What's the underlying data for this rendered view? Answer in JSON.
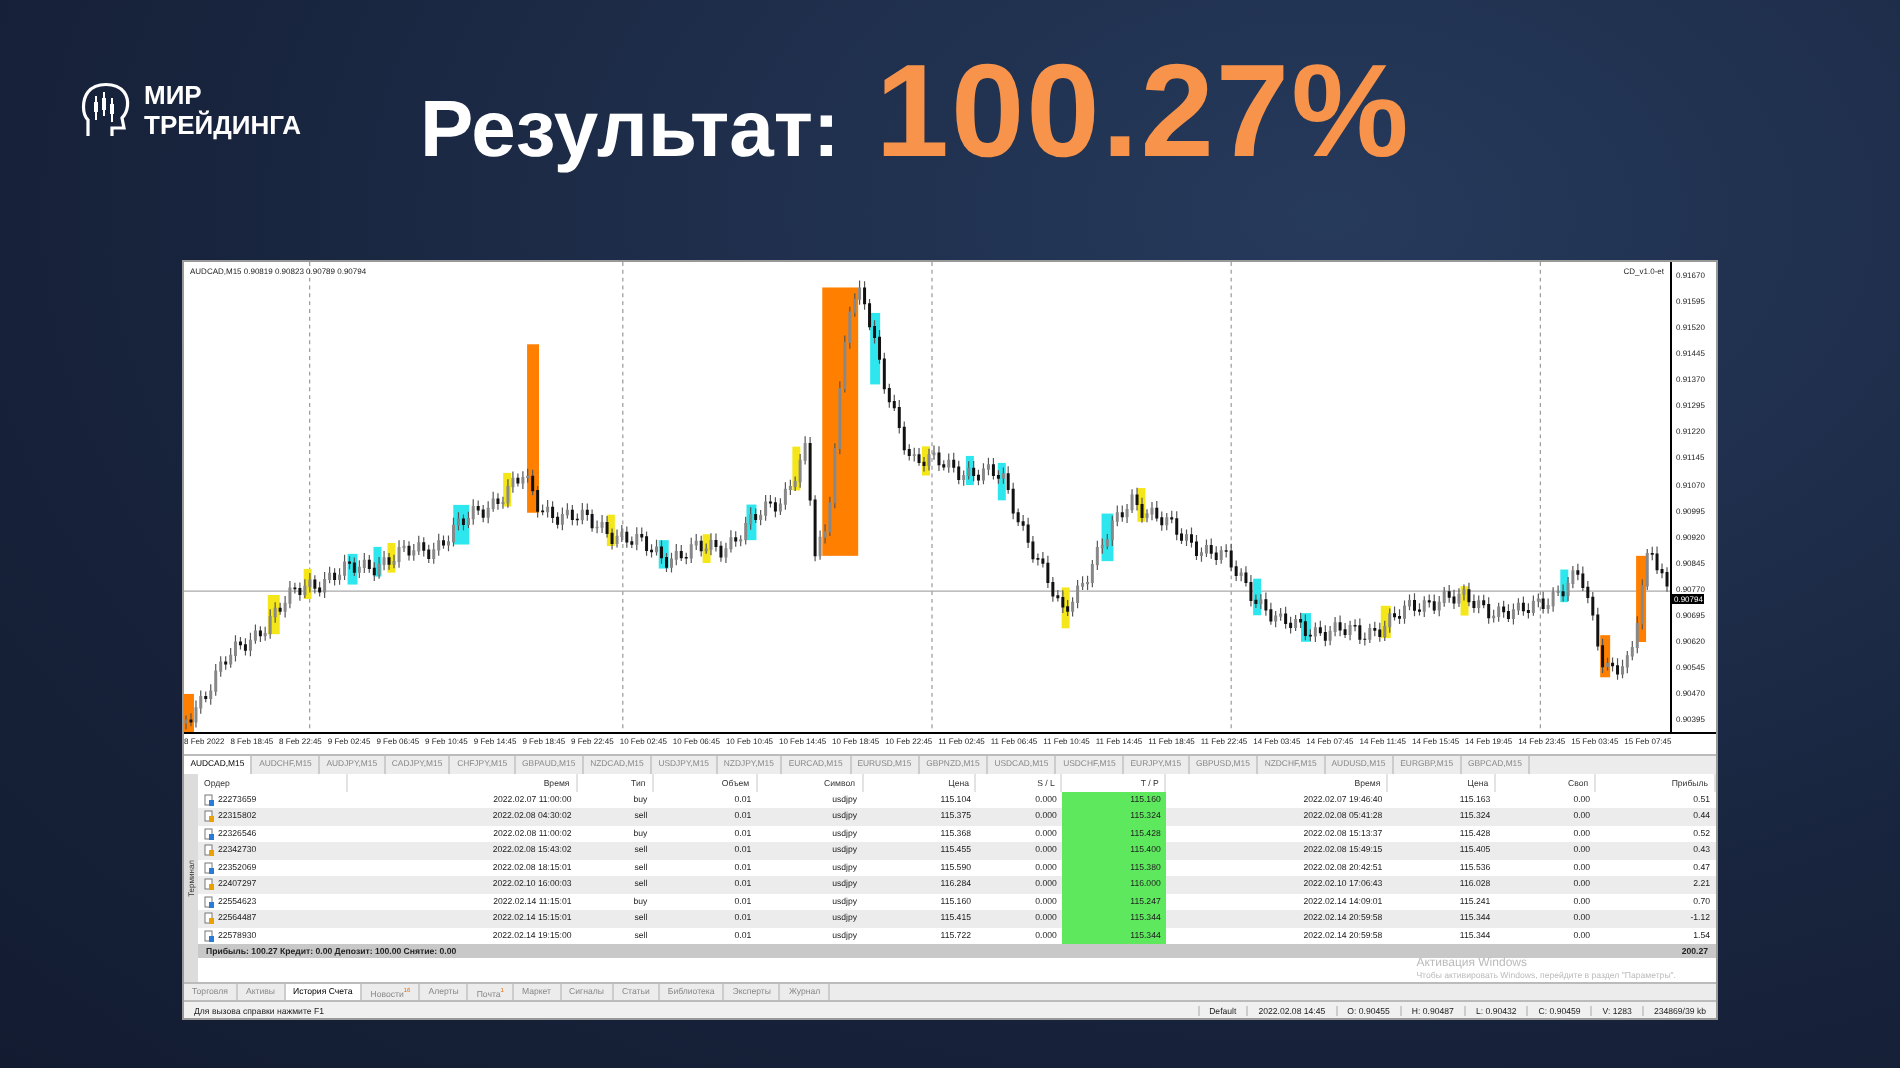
{
  "brand": {
    "lines": [
      "МИР",
      "ТРЕЙДИНГА"
    ]
  },
  "headline": {
    "label": "Результат:",
    "value": "100.27%"
  },
  "chart": {
    "symbol_info": "AUDCAD,M15  0.90819 0.90823 0.90789 0.90794",
    "indicator": "CD_v1.0-et",
    "price_marker": "0.90794",
    "price_ticks": [
      "0.91670",
      "0.91595",
      "0.91520",
      "0.91445",
      "0.91370",
      "0.91295",
      "0.91220",
      "0.91145",
      "0.91070",
      "0.90995",
      "0.90920",
      "0.90845",
      "0.90770",
      "0.90695",
      "0.90620",
      "0.90545",
      "0.90470",
      "0.90395"
    ],
    "time_ticks": [
      "8 Feb 2022",
      "8 Feb 18:45",
      "8 Feb 22:45",
      "9 Feb 02:45",
      "9 Feb 06:45",
      "9 Feb 10:45",
      "9 Feb 14:45",
      "9 Feb 18:45",
      "9 Feb 22:45",
      "10 Feb 02:45",
      "10 Feb 06:45",
      "10 Feb 10:45",
      "10 Feb 14:45",
      "10 Feb 18:45",
      "10 Feb 22:45",
      "11 Feb 02:45",
      "11 Feb 06:45",
      "11 Feb 10:45",
      "11 Feb 14:45",
      "11 Feb 18:45",
      "11 Feb 22:45",
      "14 Feb 03:45",
      "14 Feb 07:45",
      "14 Feb 11:45",
      "14 Feb 15:45",
      "14 Feb 19:45",
      "14 Feb 23:45",
      "15 Feb 03:45",
      "15 Feb 07:45"
    ]
  },
  "symbol_tabs": [
    {
      "label": "AUDCAD,M15",
      "selected": true
    },
    {
      "label": "AUDCHF,M15",
      "selected": false
    },
    {
      "label": "AUDJPY,M15",
      "selected": false
    },
    {
      "label": "CADJPY,M15",
      "selected": false
    },
    {
      "label": "CHFJPY,M15",
      "selected": false
    },
    {
      "label": "GBPAUD,M15",
      "selected": false
    },
    {
      "label": "NZDCAD,M15",
      "selected": false
    },
    {
      "label": "USDJPY,M15",
      "selected": false
    },
    {
      "label": "NZDJPY,M15",
      "selected": false
    },
    {
      "label": "EURCAD,M15",
      "selected": false
    },
    {
      "label": "EURUSD,M15",
      "selected": false
    },
    {
      "label": "GBPNZD,M15",
      "selected": false
    },
    {
      "label": "USDCAD,M15",
      "selected": false
    },
    {
      "label": "USDCHF,M15",
      "selected": false
    },
    {
      "label": "EURJPY,M15",
      "selected": false
    },
    {
      "label": "GBPUSD,M15",
      "selected": false
    },
    {
      "label": "NZDCHF,M15",
      "selected": false
    },
    {
      "label": "AUDUSD,M15",
      "selected": false
    },
    {
      "label": "EURGBP,M15",
      "selected": false
    },
    {
      "label": "GBPCAD,M15",
      "selected": false
    }
  ],
  "terminal": {
    "side_label": "Терминал",
    "columns": [
      "Ордер",
      "Время",
      "Тип",
      "Объем",
      "Символ",
      "Цена",
      "S / L",
      "T / P",
      "Время",
      "Цена",
      "Своп",
      "Прибыль"
    ],
    "rows": [
      [
        "22273659",
        "2022.02.07 11:00:00",
        "buy",
        "0.01",
        "usdjpy",
        "115.104",
        "0.000",
        "115.160",
        "2022.02.07 19:46:40",
        "115.163",
        "0.00",
        "0.51"
      ],
      [
        "22315802",
        "2022.02.08 04:30:02",
        "sell",
        "0.01",
        "usdjpy",
        "115.375",
        "0.000",
        "115.324",
        "2022.02.08 05:41:28",
        "115.324",
        "0.00",
        "0.44"
      ],
      [
        "22326546",
        "2022.02.08 11:00:02",
        "buy",
        "0.01",
        "usdjpy",
        "115.368",
        "0.000",
        "115.428",
        "2022.02.08 15:13:37",
        "115.428",
        "0.00",
        "0.52"
      ],
      [
        "22342730",
        "2022.02.08 15:43:02",
        "sell",
        "0.01",
        "usdjpy",
        "115.455",
        "0.000",
        "115.400",
        "2022.02.08 15:49:15",
        "115.405",
        "0.00",
        "0.43"
      ],
      [
        "22352069",
        "2022.02.08 18:15:01",
        "sell",
        "0.01",
        "usdjpy",
        "115.590",
        "0.000",
        "115.380",
        "2022.02.08 20:42:51",
        "115.536",
        "0.00",
        "0.47"
      ],
      [
        "22407297",
        "2022.02.10 16:00:03",
        "sell",
        "0.01",
        "usdjpy",
        "116.284",
        "0.000",
        "116.000",
        "2022.02.10 17:06:43",
        "116.028",
        "0.00",
        "2.21"
      ],
      [
        "22554623",
        "2022.02.14 11:15:01",
        "buy",
        "0.01",
        "usdjpy",
        "115.160",
        "0.000",
        "115.247",
        "2022.02.14 14:09:01",
        "115.241",
        "0.00",
        "0.70"
      ],
      [
        "22564487",
        "2022.02.14 15:15:01",
        "sell",
        "0.01",
        "usdjpy",
        "115.415",
        "0.000",
        "115.344",
        "2022.02.14 20:59:58",
        "115.344",
        "0.00",
        "-1.12"
      ],
      [
        "22578930",
        "2022.02.14 19:15:00",
        "sell",
        "0.01",
        "usdjpy",
        "115.722",
        "0.000",
        "115.344",
        "2022.02.14 20:59:58",
        "115.344",
        "0.00",
        "1.54"
      ]
    ],
    "summary": "Прибыль: 100.27  Кредит: 0.00  Депозит: 100.00  Снятие: 0.00",
    "total": "200.27",
    "tabs": [
      {
        "label": "Торговля",
        "selected": false
      },
      {
        "label": "Активы",
        "selected": false
      },
      {
        "label": "История Счета",
        "selected": true
      },
      {
        "label": "Новости",
        "selected": false,
        "badge": "16"
      },
      {
        "label": "Алерты",
        "selected": false
      },
      {
        "label": "Почта",
        "selected": false,
        "badge": "1"
      },
      {
        "label": "Маркет",
        "selected": false
      },
      {
        "label": "Сигналы",
        "selected": false
      },
      {
        "label": "Статьи",
        "selected": false
      },
      {
        "label": "Библиотека",
        "selected": false
      },
      {
        "label": "Эксперты",
        "selected": false
      },
      {
        "label": "Журнал",
        "selected": false
      }
    ]
  },
  "activation_notice": {
    "title": "Активация Windows",
    "text": "Чтобы активировать Windows, перейдите в раздел \"Параметры\"."
  },
  "status_bar": {
    "help": "Для вызова справки нажмите F1",
    "profile": "Default",
    "cells": [
      "2022.02.08 14:45",
      "O: 0.90455",
      "H: 0.90487",
      "L: 0.90432",
      "C: 0.90459",
      "V: 1283"
    ],
    "traffic": "234869/39 kb"
  }
}
